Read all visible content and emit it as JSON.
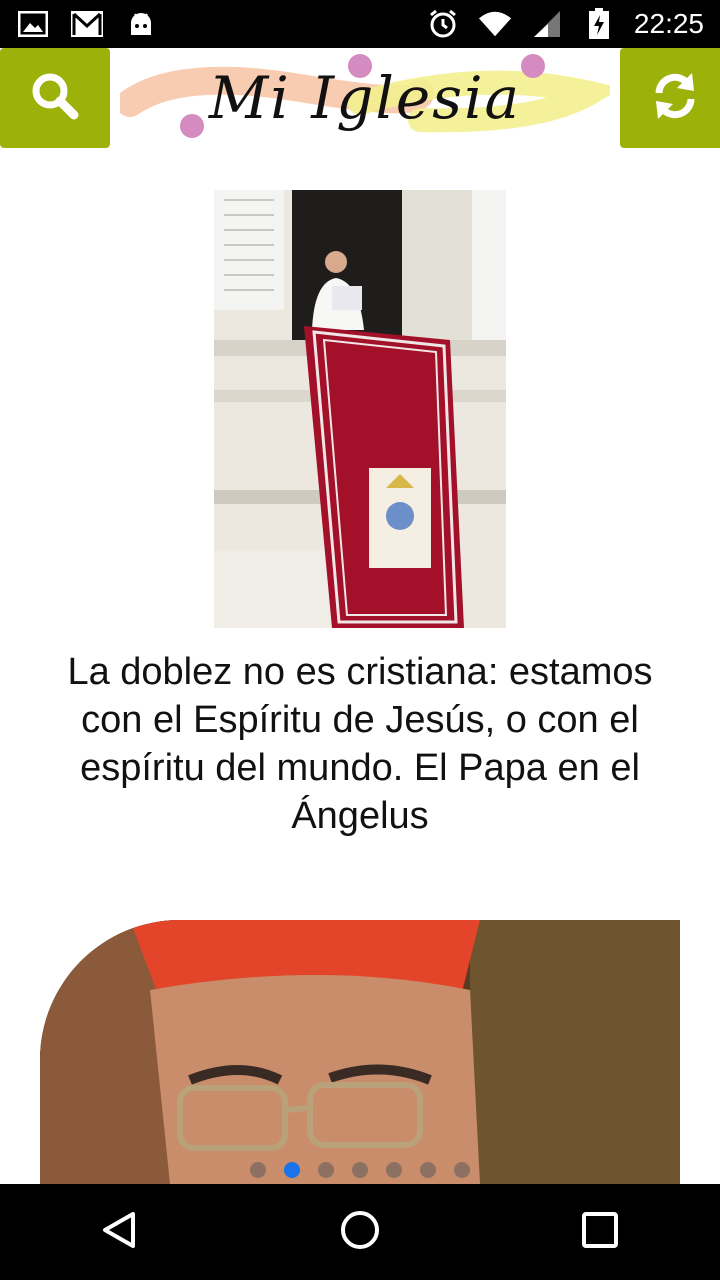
{
  "status_bar": {
    "time": "22:25",
    "left_icons": [
      "image-icon",
      "gmail-icon",
      "android-icon"
    ],
    "right_icons": [
      "alarm-icon",
      "wifi-icon",
      "signal-icon",
      "battery-charging-icon"
    ]
  },
  "header": {
    "logo_text": "Mi Iglesia",
    "search_icon": "search-icon",
    "refresh_icon": "refresh-icon",
    "accent_color": "#9db10b"
  },
  "article": {
    "title": "La doblez no es cristiana: estamos con el Espíritu de Jesús, o con el espíritu del mundo. El Papa en el Ángelus"
  },
  "carousel": {
    "dots": 7,
    "active_index": 1,
    "active_color": "#1a73e8"
  },
  "nav_bar": {
    "icons": [
      "back-icon",
      "home-icon",
      "recents-icon"
    ]
  }
}
